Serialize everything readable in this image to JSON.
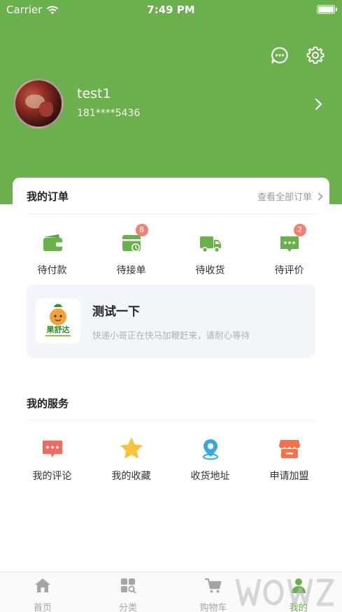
{
  "status_bar": {
    "carrier": "Carrier",
    "time": "7:49 PM"
  },
  "profile": {
    "username": "test1",
    "phone": "181****5436"
  },
  "orders": {
    "title": "我的订单",
    "see_all": "查看全部订单",
    "items": [
      {
        "label": "待付款",
        "icon": "wallet-icon"
      },
      {
        "label": "待接单",
        "icon": "receive-order-icon",
        "badge": "8"
      },
      {
        "label": "待收货",
        "icon": "delivery-truck-icon"
      },
      {
        "label": "待评价",
        "icon": "review-chat-icon",
        "badge": "2"
      }
    ]
  },
  "notice": {
    "title": "测试一下",
    "desc": "快递小哥正在快马加鞭赶来，请耐心等待",
    "logo_text": "果舒达"
  },
  "services": {
    "title": "我的服务",
    "items": [
      {
        "label": "我的评论",
        "icon": "comment-icon",
        "color": "#f06a62"
      },
      {
        "label": "我的收藏",
        "icon": "star-icon",
        "color": "#f7c33b"
      },
      {
        "label": "收货地址",
        "icon": "location-pin-icon",
        "color": "#35a8e0"
      },
      {
        "label": "申请加盟",
        "icon": "shop-icon",
        "color": "#f5734a"
      }
    ]
  },
  "tabbar": {
    "items": [
      {
        "label": "首页",
        "icon": "home-icon"
      },
      {
        "label": "分类",
        "icon": "category-icon"
      },
      {
        "label": "购物车",
        "icon": "cart-icon"
      },
      {
        "label": "我的",
        "icon": "profile-icon",
        "active": true
      }
    ]
  },
  "colors": {
    "primary": "#6ab04c",
    "badge": "#f47f72"
  }
}
